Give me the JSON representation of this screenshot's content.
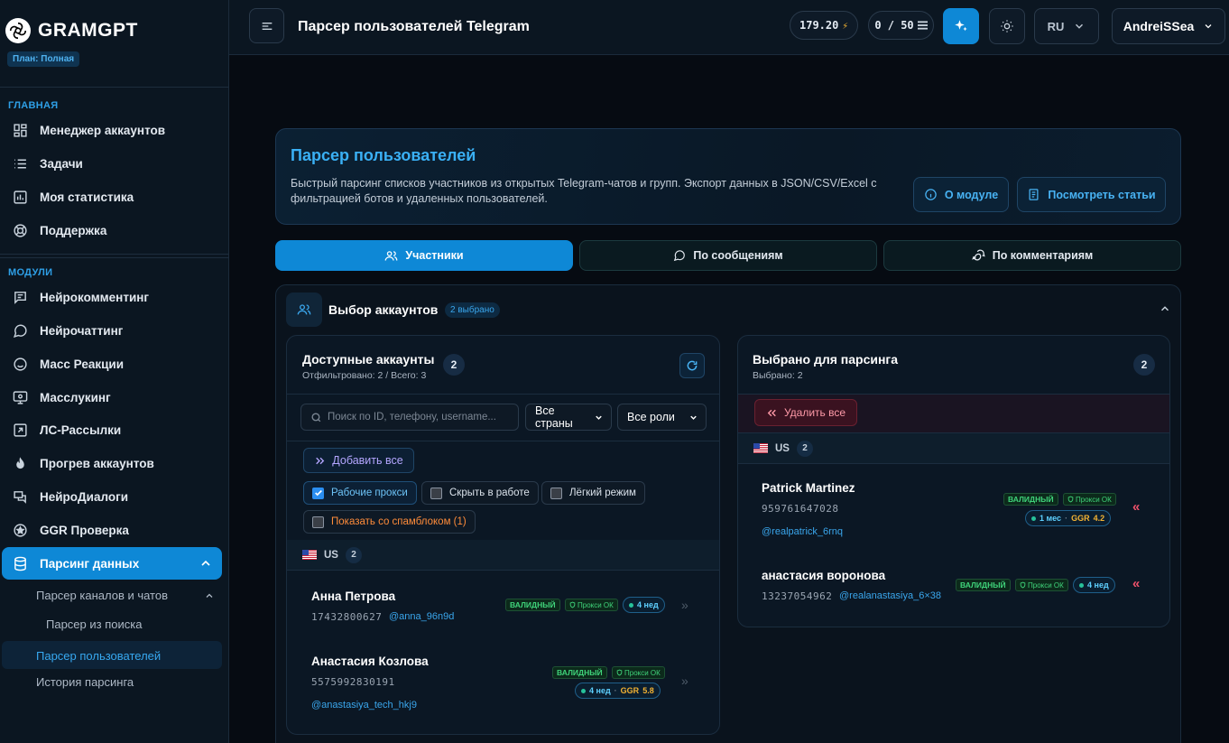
{
  "brand": {
    "name": "GRAMGPT",
    "plan": "План: Полная"
  },
  "sidebar": {
    "section_main": "ГЛАВНАЯ",
    "main_items": [
      {
        "label": "Менеджер аккаунтов",
        "icon": "grid-icon"
      },
      {
        "label": "Задачи",
        "icon": "list-icon"
      },
      {
        "label": "Моя статистика",
        "icon": "chart-icon"
      },
      {
        "label": "Поддержка",
        "icon": "lifebuoy-icon"
      }
    ],
    "section_modules": "МОДУЛИ",
    "module_items": [
      {
        "label": "Нейрокомментинг",
        "icon": "comment-icon"
      },
      {
        "label": "Нейрочаттинг",
        "icon": "chat-bubble-icon"
      },
      {
        "label": "Масс Реакции",
        "icon": "smile-icon"
      },
      {
        "label": "Масслукинг",
        "icon": "eye-screen-icon"
      },
      {
        "label": "ЛС-Рассылки",
        "icon": "share-icon"
      },
      {
        "label": "Прогрев аккаунтов",
        "icon": "flame-icon"
      },
      {
        "label": "НейроДиалоги",
        "icon": "dialogs-icon"
      },
      {
        "label": "GGR Проверка",
        "icon": "star-circle-icon"
      },
      {
        "label": "Парсинг данных",
        "icon": "database-icon"
      }
    ],
    "sub_items": [
      "Парсер каналов и чатов",
      "Парсер из поиска",
      "Парсер пользователей",
      "История парсинга"
    ]
  },
  "topbar": {
    "title": "Парсер пользователей Telegram",
    "balance": "179.20",
    "limit": "0 / 50",
    "lang": "RU",
    "user": "AndreiSSea"
  },
  "hero": {
    "title": "Парсер пользователей",
    "description": "Быстрый парсинг списков участников из открытых Telegram-чатов и групп. Экспорт данных в JSON/CSV/Excel с фильтрацией ботов и удаленных пользователей.",
    "about_btn": "О модуле",
    "articles_btn": "Посмотреть статьи"
  },
  "tabs": [
    "Участники",
    "По сообщениям",
    "По комментариям"
  ],
  "accounts": {
    "title": "Выбор аккаунтов",
    "selected_badge": "2 выбрано",
    "available": {
      "title": "Доступные аккаунты",
      "subtitle": "Отфильтровано: 2 / Всего: 3",
      "count": "2",
      "search_placeholder": "Поиск по ID, телефону, username...",
      "country_select": "Все страны",
      "role_select": "Все роли",
      "add_all": "Добавить все",
      "filters": {
        "working_proxy": "Рабочие прокси",
        "hide_in_work": "Скрыть в работе",
        "light_mode": "Лёгкий режим",
        "show_spamblock": "Показать со спамблоком (1)"
      },
      "group": {
        "country": "US",
        "count": "2"
      },
      "users": [
        {
          "name": "Анна Петрова",
          "phone": "17432800627",
          "handle": "@anna_96n9d",
          "status": "ВАЛИДНЫЙ",
          "proxy": "Прокси ОК",
          "age": "4 нед",
          "ggr_label": "",
          "ggr": ""
        },
        {
          "name": "Анастасия Козлова",
          "phone": "5575992830191",
          "handle": "@anastasiya_tech_hkj9",
          "status": "ВАЛИДНЫЙ",
          "proxy": "Прокси ОК",
          "age": "4 нед",
          "ggr_label": "GGR",
          "ggr": "5.8"
        }
      ]
    },
    "selected": {
      "title": "Выбрано для парсинга",
      "subtitle": "Выбрано: 2",
      "count": "2",
      "remove_all": "Удалить все",
      "group": {
        "country": "US",
        "count": "2"
      },
      "users": [
        {
          "name": "Patrick Martinez",
          "phone": "959761647028",
          "handle": "@realpatrick_6rnq",
          "status": "ВАЛИДНЫЙ",
          "proxy": "Прокси ОК",
          "age": "1 мес",
          "ggr_label": "GGR",
          "ggr": "4.2"
        },
        {
          "name": "анастасия воронова",
          "phone": "13237054962",
          "handle": "@realanastasiya_6×38",
          "status": "ВАЛИДНЫЙ",
          "proxy": "Прокси ОК",
          "age": "4 нед",
          "ggr_label": "",
          "ggr": ""
        }
      ]
    }
  },
  "colors": {
    "accent": "#0e88d6",
    "valid": "#3fd37a",
    "danger": "#f0526b",
    "ggr": "#f2b233"
  }
}
